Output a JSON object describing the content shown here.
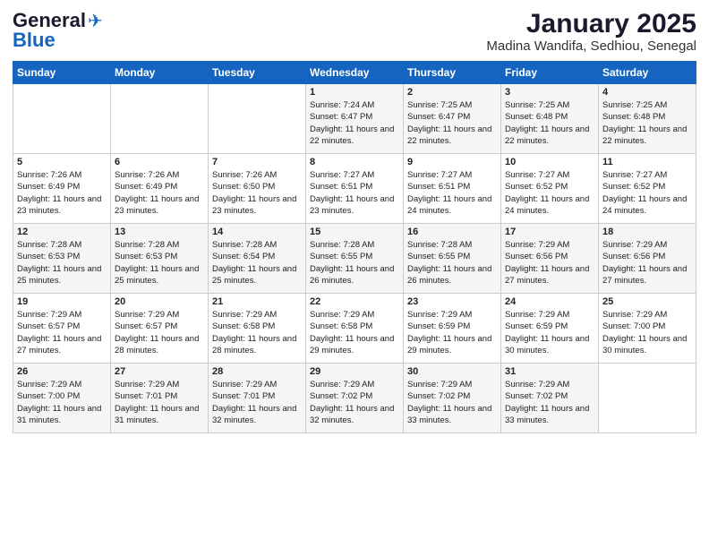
{
  "header": {
    "logo_general": "General",
    "logo_blue": "Blue",
    "title": "January 2025",
    "subtitle": "Madina Wandifa, Sedhiou, Senegal"
  },
  "days_of_week": [
    "Sunday",
    "Monday",
    "Tuesday",
    "Wednesday",
    "Thursday",
    "Friday",
    "Saturday"
  ],
  "weeks": [
    [
      {
        "num": "",
        "sunrise": "",
        "sunset": "",
        "daylight": ""
      },
      {
        "num": "",
        "sunrise": "",
        "sunset": "",
        "daylight": ""
      },
      {
        "num": "",
        "sunrise": "",
        "sunset": "",
        "daylight": ""
      },
      {
        "num": "1",
        "sunrise": "Sunrise: 7:24 AM",
        "sunset": "Sunset: 6:47 PM",
        "daylight": "Daylight: 11 hours and 22 minutes."
      },
      {
        "num": "2",
        "sunrise": "Sunrise: 7:25 AM",
        "sunset": "Sunset: 6:47 PM",
        "daylight": "Daylight: 11 hours and 22 minutes."
      },
      {
        "num": "3",
        "sunrise": "Sunrise: 7:25 AM",
        "sunset": "Sunset: 6:48 PM",
        "daylight": "Daylight: 11 hours and 22 minutes."
      },
      {
        "num": "4",
        "sunrise": "Sunrise: 7:25 AM",
        "sunset": "Sunset: 6:48 PM",
        "daylight": "Daylight: 11 hours and 22 minutes."
      }
    ],
    [
      {
        "num": "5",
        "sunrise": "Sunrise: 7:26 AM",
        "sunset": "Sunset: 6:49 PM",
        "daylight": "Daylight: 11 hours and 23 minutes."
      },
      {
        "num": "6",
        "sunrise": "Sunrise: 7:26 AM",
        "sunset": "Sunset: 6:49 PM",
        "daylight": "Daylight: 11 hours and 23 minutes."
      },
      {
        "num": "7",
        "sunrise": "Sunrise: 7:26 AM",
        "sunset": "Sunset: 6:50 PM",
        "daylight": "Daylight: 11 hours and 23 minutes."
      },
      {
        "num": "8",
        "sunrise": "Sunrise: 7:27 AM",
        "sunset": "Sunset: 6:51 PM",
        "daylight": "Daylight: 11 hours and 23 minutes."
      },
      {
        "num": "9",
        "sunrise": "Sunrise: 7:27 AM",
        "sunset": "Sunset: 6:51 PM",
        "daylight": "Daylight: 11 hours and 24 minutes."
      },
      {
        "num": "10",
        "sunrise": "Sunrise: 7:27 AM",
        "sunset": "Sunset: 6:52 PM",
        "daylight": "Daylight: 11 hours and 24 minutes."
      },
      {
        "num": "11",
        "sunrise": "Sunrise: 7:27 AM",
        "sunset": "Sunset: 6:52 PM",
        "daylight": "Daylight: 11 hours and 24 minutes."
      }
    ],
    [
      {
        "num": "12",
        "sunrise": "Sunrise: 7:28 AM",
        "sunset": "Sunset: 6:53 PM",
        "daylight": "Daylight: 11 hours and 25 minutes."
      },
      {
        "num": "13",
        "sunrise": "Sunrise: 7:28 AM",
        "sunset": "Sunset: 6:53 PM",
        "daylight": "Daylight: 11 hours and 25 minutes."
      },
      {
        "num": "14",
        "sunrise": "Sunrise: 7:28 AM",
        "sunset": "Sunset: 6:54 PM",
        "daylight": "Daylight: 11 hours and 25 minutes."
      },
      {
        "num": "15",
        "sunrise": "Sunrise: 7:28 AM",
        "sunset": "Sunset: 6:55 PM",
        "daylight": "Daylight: 11 hours and 26 minutes."
      },
      {
        "num": "16",
        "sunrise": "Sunrise: 7:28 AM",
        "sunset": "Sunset: 6:55 PM",
        "daylight": "Daylight: 11 hours and 26 minutes."
      },
      {
        "num": "17",
        "sunrise": "Sunrise: 7:29 AM",
        "sunset": "Sunset: 6:56 PM",
        "daylight": "Daylight: 11 hours and 27 minutes."
      },
      {
        "num": "18",
        "sunrise": "Sunrise: 7:29 AM",
        "sunset": "Sunset: 6:56 PM",
        "daylight": "Daylight: 11 hours and 27 minutes."
      }
    ],
    [
      {
        "num": "19",
        "sunrise": "Sunrise: 7:29 AM",
        "sunset": "Sunset: 6:57 PM",
        "daylight": "Daylight: 11 hours and 27 minutes."
      },
      {
        "num": "20",
        "sunrise": "Sunrise: 7:29 AM",
        "sunset": "Sunset: 6:57 PM",
        "daylight": "Daylight: 11 hours and 28 minutes."
      },
      {
        "num": "21",
        "sunrise": "Sunrise: 7:29 AM",
        "sunset": "Sunset: 6:58 PM",
        "daylight": "Daylight: 11 hours and 28 minutes."
      },
      {
        "num": "22",
        "sunrise": "Sunrise: 7:29 AM",
        "sunset": "Sunset: 6:58 PM",
        "daylight": "Daylight: 11 hours and 29 minutes."
      },
      {
        "num": "23",
        "sunrise": "Sunrise: 7:29 AM",
        "sunset": "Sunset: 6:59 PM",
        "daylight": "Daylight: 11 hours and 29 minutes."
      },
      {
        "num": "24",
        "sunrise": "Sunrise: 7:29 AM",
        "sunset": "Sunset: 6:59 PM",
        "daylight": "Daylight: 11 hours and 30 minutes."
      },
      {
        "num": "25",
        "sunrise": "Sunrise: 7:29 AM",
        "sunset": "Sunset: 7:00 PM",
        "daylight": "Daylight: 11 hours and 30 minutes."
      }
    ],
    [
      {
        "num": "26",
        "sunrise": "Sunrise: 7:29 AM",
        "sunset": "Sunset: 7:00 PM",
        "daylight": "Daylight: 11 hours and 31 minutes."
      },
      {
        "num": "27",
        "sunrise": "Sunrise: 7:29 AM",
        "sunset": "Sunset: 7:01 PM",
        "daylight": "Daylight: 11 hours and 31 minutes."
      },
      {
        "num": "28",
        "sunrise": "Sunrise: 7:29 AM",
        "sunset": "Sunset: 7:01 PM",
        "daylight": "Daylight: 11 hours and 32 minutes."
      },
      {
        "num": "29",
        "sunrise": "Sunrise: 7:29 AM",
        "sunset": "Sunset: 7:02 PM",
        "daylight": "Daylight: 11 hours and 32 minutes."
      },
      {
        "num": "30",
        "sunrise": "Sunrise: 7:29 AM",
        "sunset": "Sunset: 7:02 PM",
        "daylight": "Daylight: 11 hours and 33 minutes."
      },
      {
        "num": "31",
        "sunrise": "Sunrise: 7:29 AM",
        "sunset": "Sunset: 7:02 PM",
        "daylight": "Daylight: 11 hours and 33 minutes."
      },
      {
        "num": "",
        "sunrise": "",
        "sunset": "",
        "daylight": ""
      }
    ]
  ]
}
